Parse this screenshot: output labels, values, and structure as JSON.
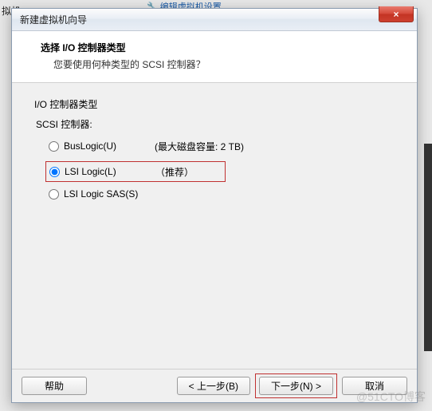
{
  "background": {
    "left_text": "拟机",
    "edit_link": "编辑虚拟机设置"
  },
  "dialog": {
    "title": "新建虚拟机向导",
    "close": "×",
    "header": {
      "title": "选择 I/O 控制器类型",
      "subtitle": "您要使用何种类型的 SCSI 控制器？"
    },
    "content": {
      "group_label": "I/O 控制器类型",
      "sub_label": "SCSI 控制器:",
      "options": [
        {
          "label": "BusLogic(U)",
          "note": "(最大磁盘容量: 2 TB)",
          "selected": false
        },
        {
          "label": "LSI Logic(L)",
          "note": "（推荐）",
          "selected": true
        },
        {
          "label": "LSI Logic SAS(S)",
          "note": "",
          "selected": false
        }
      ]
    },
    "buttons": {
      "help": "帮助",
      "back": "< 上一步(B)",
      "next": "下一步(N) >",
      "cancel": "取消"
    }
  },
  "watermark": "@51CTO博客"
}
